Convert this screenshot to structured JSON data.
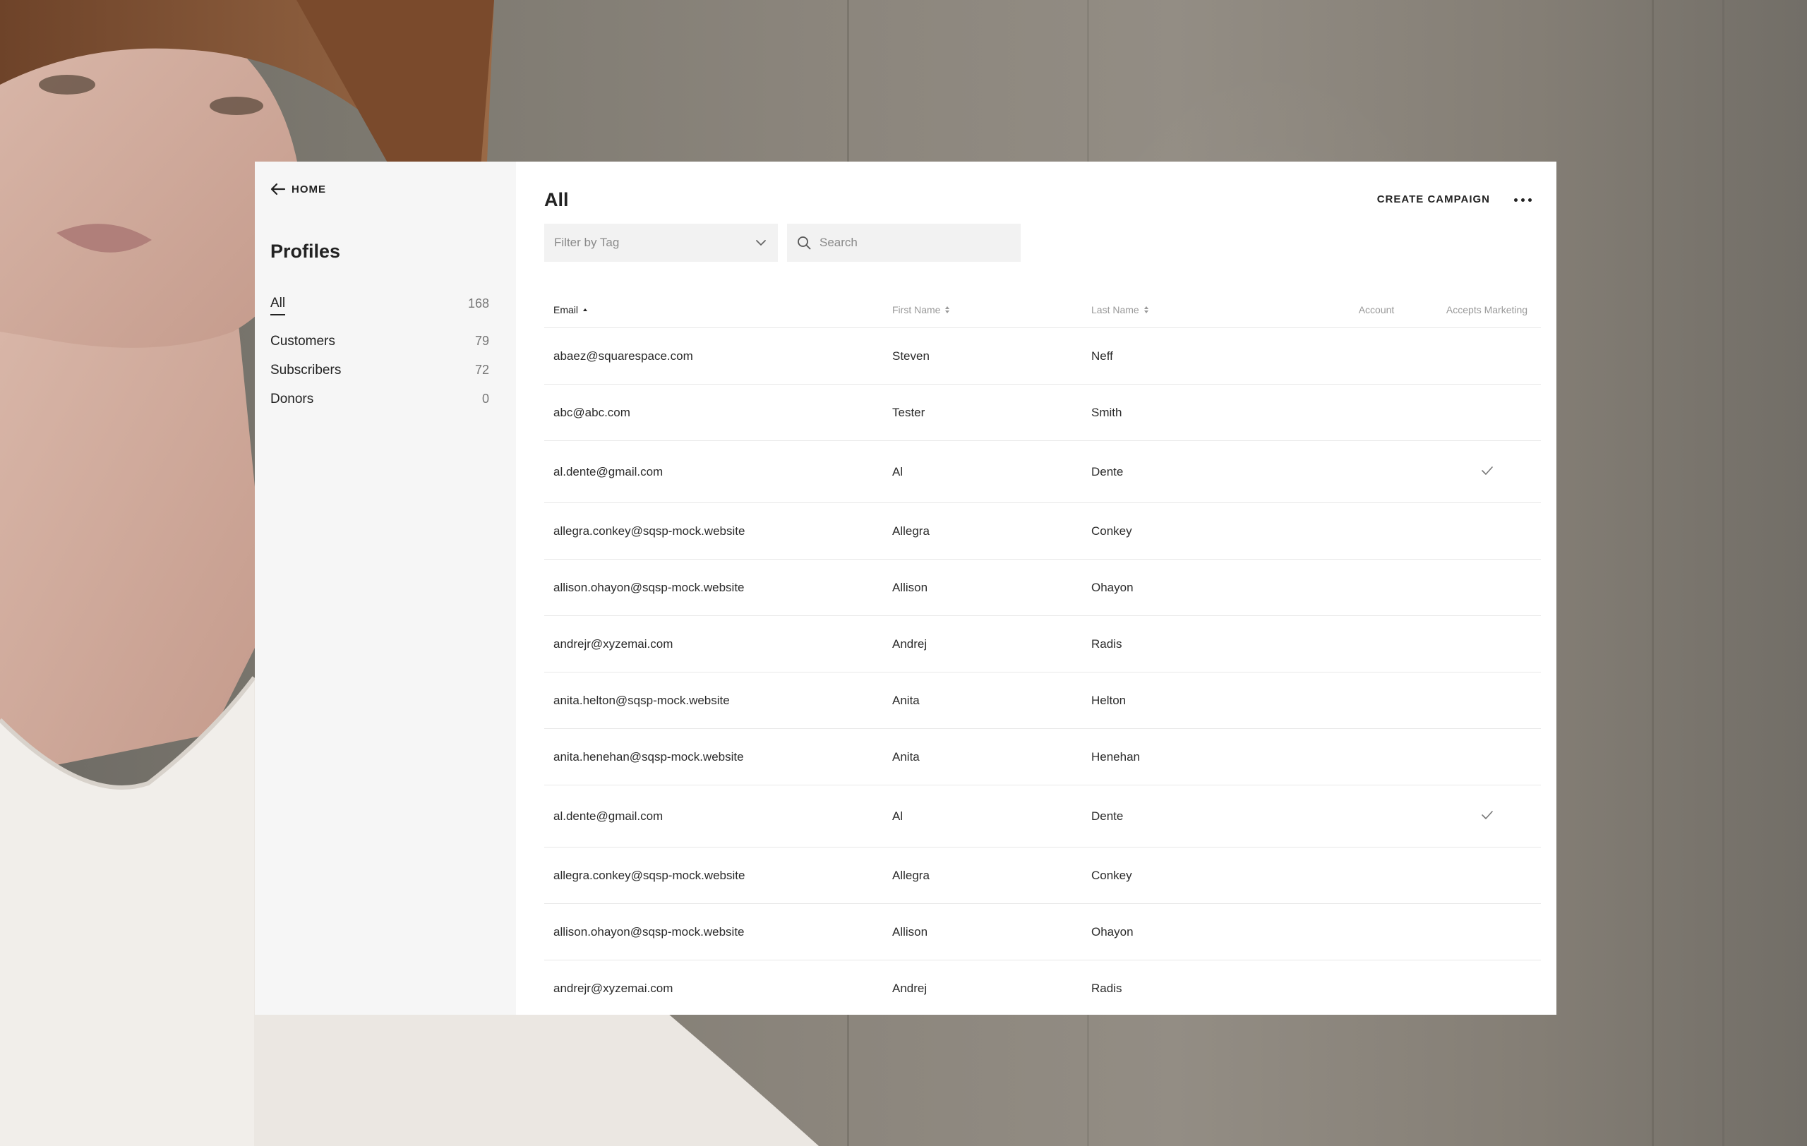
{
  "sidebar": {
    "home_label": "HOME",
    "title": "Profiles",
    "items": [
      {
        "label": "All",
        "count": "168"
      },
      {
        "label": "Customers",
        "count": "79"
      },
      {
        "label": "Subscribers",
        "count": "72"
      },
      {
        "label": "Donors",
        "count": "0"
      }
    ]
  },
  "header": {
    "title": "All",
    "create_campaign_label": "CREATE CAMPAIGN"
  },
  "filters": {
    "tag_placeholder": "Filter by Tag",
    "search_placeholder": "Search"
  },
  "table": {
    "columns": {
      "email": "Email",
      "first_name": "First Name",
      "last_name": "Last Name",
      "account": "Account",
      "accepts_marketing": "Accepts Marketing"
    },
    "rows": [
      {
        "email": "abaez@squarespace.com",
        "first": "Steven",
        "last": "Neff",
        "accepts": false
      },
      {
        "email": "abc@abc.com",
        "first": "Tester",
        "last": "Smith",
        "accepts": false
      },
      {
        "email": "al.dente@gmail.com",
        "first": "Al",
        "last": "Dente",
        "accepts": true
      },
      {
        "email": "allegra.conkey@sqsp-mock.website",
        "first": "Allegra",
        "last": "Conkey",
        "accepts": false
      },
      {
        "email": "allison.ohayon@sqsp-mock.website",
        "first": "Allison",
        "last": "Ohayon",
        "accepts": false
      },
      {
        "email": "andrejr@xyzemai.com",
        "first": "Andrej",
        "last": "Radis",
        "accepts": false
      },
      {
        "email": "anita.helton@sqsp-mock.website",
        "first": "Anita",
        "last": "Helton",
        "accepts": false
      },
      {
        "email": "anita.henehan@sqsp-mock.website",
        "first": "Anita",
        "last": "Henehan",
        "accepts": false
      },
      {
        "email": "al.dente@gmail.com",
        "first": "Al",
        "last": "Dente",
        "accepts": true
      },
      {
        "email": "allegra.conkey@sqsp-mock.website",
        "first": "Allegra",
        "last": "Conkey",
        "accepts": false
      },
      {
        "email": "allison.ohayon@sqsp-mock.website",
        "first": "Allison",
        "last": "Ohayon",
        "accepts": false
      },
      {
        "email": "andrejr@xyzemai.com",
        "first": "Andrej",
        "last": "Radis",
        "accepts": false
      }
    ]
  },
  "icons": {
    "back": "arrow-left-icon",
    "dropdown": "chevron-down-icon",
    "search": "search-icon",
    "more": "more-horizontal-icon",
    "sort": "sort-icon",
    "check": "check-icon"
  },
  "colors": {
    "text": "#222222",
    "muted": "#999999",
    "sidebar_bg": "#f6f6f6",
    "input_bg": "#f2f2f2",
    "divider": "#e8e8e8"
  }
}
